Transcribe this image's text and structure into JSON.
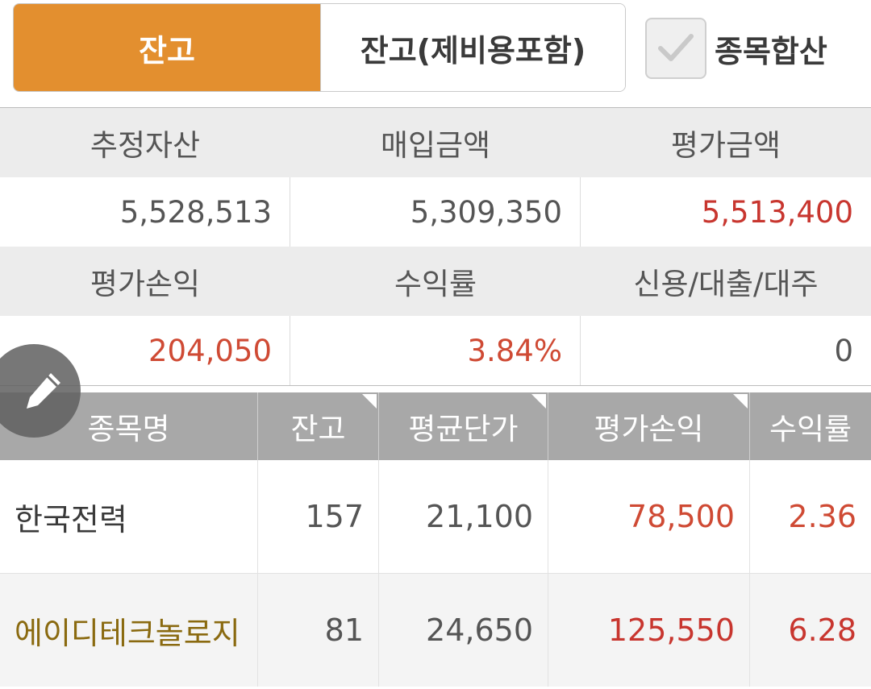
{
  "toggle": {
    "balance_label": "잔고",
    "balance_with_fee_label": "잔고(제비용포함)",
    "aggregate_label": "종목합산",
    "aggregate_checked": true
  },
  "summary": {
    "labels_row1": [
      "추정자산",
      "매입금액",
      "평가금액"
    ],
    "values_row1": [
      "5,528,513",
      "5,309,350",
      "5,513,400"
    ],
    "labels_row2": [
      "평가손익",
      "수익률",
      "신용/대출/대주"
    ],
    "values_row2": [
      "204,050",
      "3.84%",
      "0"
    ]
  },
  "table": {
    "columns": [
      "종목명",
      "잔고",
      "평균단가",
      "평가손익",
      "수익률"
    ],
    "rows": [
      {
        "name": "한국전력",
        "qty": "157",
        "avg_price": "21,100",
        "profit": "78,500",
        "rate": "2.36"
      },
      {
        "name": "에이디테크놀로지",
        "qty": "81",
        "avg_price": "24,650",
        "profit": "125,550",
        "rate": "6.28"
      }
    ]
  },
  "colors": {
    "accent": "#e38f2f",
    "positive": "#c8362f",
    "header_bg": "#a8a8a8",
    "highlight_name": "#8a6a10"
  },
  "icons": {
    "check": "check-icon",
    "edit": "pencil-icon"
  }
}
